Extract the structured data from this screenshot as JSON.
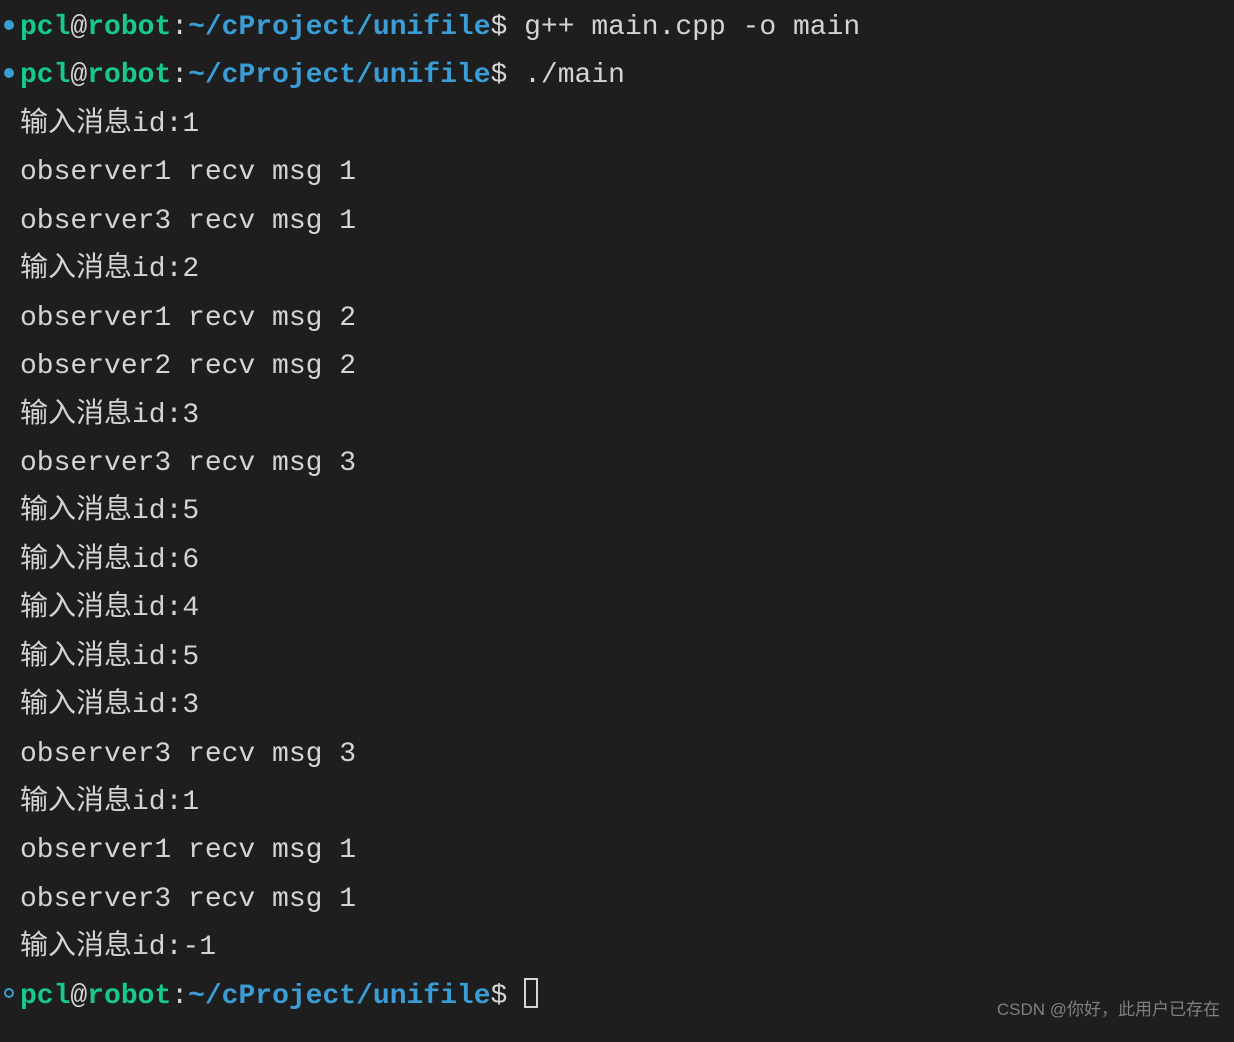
{
  "prompts": [
    {
      "bullet": "filled",
      "user": "pcl",
      "host": "robot",
      "path": "~/cProject/unifile",
      "command": "g++ main.cpp -o main"
    },
    {
      "bullet": "filled",
      "user": "pcl",
      "host": "robot",
      "path": "~/cProject/unifile",
      "command": "./main"
    }
  ],
  "output_lines": [
    "输入消息id:1",
    "observer1 recv msg 1",
    "observer3 recv msg 1",
    "输入消息id:2",
    "observer1 recv msg 2",
    "observer2 recv msg 2",
    "输入消息id:3",
    "observer3 recv msg 3",
    "输入消息id:5",
    "输入消息id:6",
    "输入消息id:4",
    "输入消息id:5",
    "输入消息id:3",
    "observer3 recv msg 3",
    "输入消息id:1",
    "observer1 recv msg 1",
    "observer3 recv msg 1",
    "输入消息id:-1"
  ],
  "final_prompt": {
    "bullet": "hollow",
    "user": "pcl",
    "host": "robot",
    "path": "~/cProject/unifile",
    "command": ""
  },
  "watermark": "CSDN @你好，此用户已存在"
}
